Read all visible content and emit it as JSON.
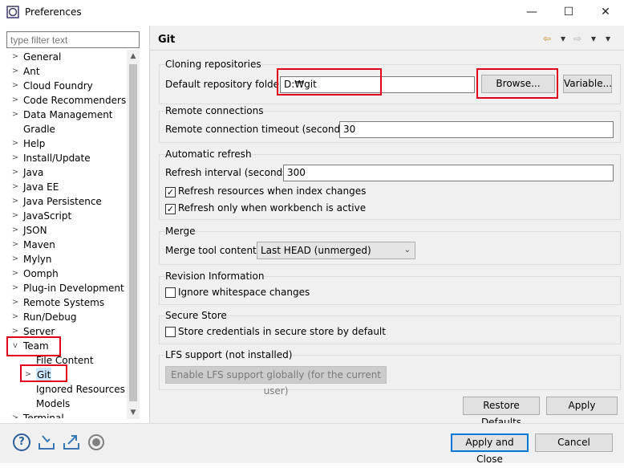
{
  "window": {
    "title": "Preferences",
    "minimize": "—",
    "maximize": "☐",
    "close": "✕"
  },
  "sidebar": {
    "filter_placeholder": "type filter text",
    "items": [
      {
        "label": "General",
        "arrow": ">"
      },
      {
        "label": "Ant",
        "arrow": ">"
      },
      {
        "label": "Cloud Foundry",
        "arrow": ">"
      },
      {
        "label": "Code Recommenders",
        "arrow": ">"
      },
      {
        "label": "Data Management",
        "arrow": ">"
      },
      {
        "label": "Gradle",
        "arrow": ""
      },
      {
        "label": "Help",
        "arrow": ">"
      },
      {
        "label": "Install/Update",
        "arrow": ">"
      },
      {
        "label": "Java",
        "arrow": ">"
      },
      {
        "label": "Java EE",
        "arrow": ">"
      },
      {
        "label": "Java Persistence",
        "arrow": ">"
      },
      {
        "label": "JavaScript",
        "arrow": ">"
      },
      {
        "label": "JSON",
        "arrow": ">"
      },
      {
        "label": "Maven",
        "arrow": ">"
      },
      {
        "label": "Mylyn",
        "arrow": ">"
      },
      {
        "label": "Oomph",
        "arrow": ">"
      },
      {
        "label": "Plug-in Development",
        "arrow": ">"
      },
      {
        "label": "Remote Systems",
        "arrow": ">"
      },
      {
        "label": "Run/Debug",
        "arrow": ">"
      },
      {
        "label": "Server",
        "arrow": ">"
      },
      {
        "label": "Team",
        "arrow": "v"
      },
      {
        "label": "File Content",
        "arrow": ""
      },
      {
        "label": "Git",
        "arrow": ">"
      },
      {
        "label": "Ignored Resources",
        "arrow": ""
      },
      {
        "label": "Models",
        "arrow": ""
      },
      {
        "label": "Terminal",
        "arrow": ">"
      }
    ]
  },
  "page": {
    "title": "Git",
    "nav": {
      "back": "⇦",
      "back_menu": "▾",
      "forward": "⇨",
      "forward_menu": "▾",
      "view_menu": "▾"
    },
    "cloning": {
      "title": "Cloning repositories",
      "folder_label": "Default repository folder:",
      "folder_value": "D:₩git",
      "browse": "Browse...",
      "variable": "Variable..."
    },
    "remote": {
      "title": "Remote connections",
      "timeout_label": "Remote connection timeout (seconds):",
      "timeout_value": "30"
    },
    "refresh": {
      "title": "Automatic refresh",
      "interval_label": "Refresh interval (seconds):",
      "interval_value": "300",
      "check1": "Refresh resources when index changes",
      "check2": "Refresh only when workbench is active",
      "check_mark": "✓"
    },
    "merge": {
      "title": "Merge",
      "tool_label": "Merge tool content:",
      "tool_value": "Last HEAD (unmerged)",
      "dropdown": "⌄"
    },
    "revision": {
      "title": "Revision Information",
      "check": "Ignore whitespace changes"
    },
    "secure": {
      "title": "Secure Store",
      "check": "Store credentials in secure store by default"
    },
    "lfs": {
      "title": "LFS support (not installed)",
      "button": "Enable LFS support globally (for the current user)"
    },
    "restore_defaults": "Restore Defaults",
    "apply": "Apply"
  },
  "footer": {
    "help": "?",
    "apply_close": "Apply and Close",
    "cancel": "Cancel"
  },
  "colors": {
    "highlight": "#e0001b",
    "accent": "#0078d7"
  }
}
